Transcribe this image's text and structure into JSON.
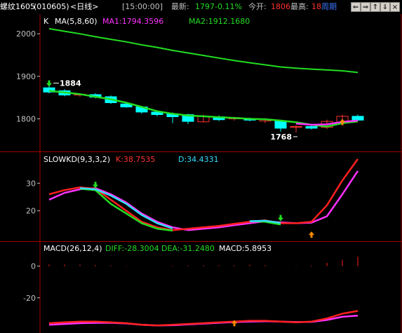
{
  "header": {
    "symbol": "螺纹1605",
    "code": "(010605)",
    "period": "<日线>",
    "time": "[15:00:00]",
    "latest_label": "最新:",
    "latest_value": "1797",
    "change": "-0.11%",
    "open_label": "今开:",
    "open_value": "1806",
    "high_label": "最高:",
    "high_value": "18",
    "week_label": "周期",
    "nav_icons": [
      "arrow-left-icon",
      "arrow-right-icon",
      "arrow-up-icon",
      "arrow-down-icon",
      "close-icon"
    ]
  },
  "colors": {
    "bg": "#000000",
    "divider": "#a00000",
    "axis": "#c0c0c0",
    "bull_candle": "#ff3232",
    "bear_candle": "#00ffff",
    "green_line": "#22dd22",
    "magenta_line": "#ff32ff",
    "red_line": "#ff2020",
    "cyan_line": "#33ddff"
  },
  "chart_data": [
    {
      "type": "line",
      "panel": "main",
      "legend_prefix": "K",
      "indicator": "MA(5,8,60)",
      "ma1_label": "MA1:1794.3596",
      "ma2_label": "MA2:1912.1680",
      "yticks": [
        2000,
        1900,
        1800
      ],
      "ylim": [
        1730,
        2030
      ],
      "annotations": {
        "high": "1884",
        "low": "1768"
      },
      "candles": [
        {
          "o": 1873,
          "h": 1884,
          "l": 1860,
          "c": 1863
        },
        {
          "o": 1866,
          "h": 1870,
          "l": 1853,
          "c": 1856
        },
        {
          "o": 1856,
          "h": 1860,
          "l": 1852,
          "c": 1858
        },
        {
          "o": 1857,
          "h": 1860,
          "l": 1848,
          "c": 1851
        },
        {
          "o": 1852,
          "h": 1855,
          "l": 1835,
          "c": 1838
        },
        {
          "o": 1835,
          "h": 1838,
          "l": 1826,
          "c": 1828
        },
        {
          "o": 1828,
          "h": 1830,
          "l": 1812,
          "c": 1816
        },
        {
          "o": 1816,
          "h": 1820,
          "l": 1806,
          "c": 1810
        },
        {
          "o": 1812,
          "h": 1815,
          "l": 1790,
          "c": 1805
        },
        {
          "o": 1810,
          "h": 1812,
          "l": 1788,
          "c": 1794
        },
        {
          "o": 1793,
          "h": 1810,
          "l": 1792,
          "c": 1806
        },
        {
          "o": 1805,
          "h": 1808,
          "l": 1795,
          "c": 1798
        },
        {
          "o": 1800,
          "h": 1805,
          "l": 1796,
          "c": 1803
        },
        {
          "o": 1800,
          "h": 1803,
          "l": 1794,
          "c": 1797
        },
        {
          "o": 1795,
          "h": 1802,
          "l": 1790,
          "c": 1799
        },
        {
          "o": 1795,
          "h": 1797,
          "l": 1770,
          "c": 1778
        },
        {
          "o": 1780,
          "h": 1785,
          "l": 1768,
          "c": 1782
        },
        {
          "o": 1782,
          "h": 1785,
          "l": 1775,
          "c": 1778
        },
        {
          "o": 1780,
          "h": 1798,
          "l": 1776,
          "c": 1794
        },
        {
          "o": 1792,
          "h": 1810,
          "l": 1790,
          "c": 1806
        },
        {
          "o": 1806,
          "h": 1810,
          "l": 1795,
          "c": 1797
        }
      ],
      "ma60": [
        2012,
        2006,
        2000,
        1993,
        1987,
        1981,
        1974,
        1968,
        1961,
        1955,
        1949,
        1943,
        1937,
        1932,
        1927,
        1922,
        1919,
        1917,
        1915,
        1913,
        1909
      ],
      "ma_short": [
        1866,
        1862,
        1858,
        1852,
        1846,
        1838,
        1828,
        1818,
        1812,
        1808,
        1806,
        1804,
        1802,
        1800,
        1799,
        1796,
        1792,
        1786,
        1782,
        1790,
        1794
      ],
      "ma_mid": [
        null,
        null,
        null,
        null,
        null,
        null,
        null,
        null,
        null,
        null,
        null,
        null,
        null,
        null,
        null,
        null,
        1789,
        1786,
        1787,
        1793,
        1796
      ]
    },
    {
      "type": "line",
      "panel": "kd",
      "legend": "SLOWKD(9,3,3,2)",
      "k_label": "K:38.7535",
      "d_label": "D:34.4331",
      "yticks": [
        30,
        20
      ],
      "ylim": [
        10,
        40
      ],
      "k": [
        26,
        27.5,
        28.5,
        28,
        24,
        20,
        16,
        14,
        13,
        13.5,
        14,
        14.5,
        15.3,
        16,
        16.5,
        15.5,
        15.5,
        16,
        22,
        31,
        38.75
      ],
      "d": [
        24,
        26.5,
        27.8,
        28.2,
        26,
        23,
        19,
        16,
        14,
        13,
        13.5,
        14,
        14.8,
        15.5,
        16.2,
        15.8,
        15.5,
        15.7,
        18,
        26,
        34.43
      ],
      "k2": [
        null,
        null,
        28,
        27.5,
        22.5,
        19,
        15.5,
        13.5,
        12.8,
        null,
        null,
        null,
        null,
        16.3,
        16,
        15,
        null,
        null,
        null,
        null,
        null
      ],
      "k2_alt": [
        null,
        null,
        28.2,
        27.8,
        25.5,
        22.5,
        18.5,
        15.5,
        13.6,
        null,
        null,
        null,
        null,
        16.2,
        16.4,
        15.6,
        null,
        null,
        null,
        null,
        null
      ]
    },
    {
      "type": "line",
      "panel": "macd",
      "legend": "MACD(26,12,4)",
      "diff_label": "DIFF:-28.3004",
      "dea_label": "DEA:-31.2480",
      "macd_label": "MACD:5.8953",
      "yticks": [
        0,
        -20
      ],
      "ylim": [
        -40,
        6
      ],
      "diff": [
        -36,
        -35.5,
        -35,
        -35,
        -35.5,
        -36,
        -37,
        -37.5,
        -37,
        -36.5,
        -36,
        -35.5,
        -35,
        -34.5,
        -34.5,
        -35,
        -35.5,
        -35,
        -33,
        -30,
        -28.3
      ],
      "dea": [
        -37,
        -36.5,
        -36,
        -35.8,
        -35.8,
        -36.2,
        -37,
        -37.5,
        -37.3,
        -36.8,
        -36.3,
        -35.8,
        -35.3,
        -35,
        -34.8,
        -35,
        -35.3,
        -35.2,
        -34,
        -32,
        -31.25
      ],
      "hist": [
        1.0,
        1.0,
        0.9,
        0.7,
        0.4,
        0.2,
        0.0,
        0.0,
        0.3,
        0.4,
        0.5,
        0.6,
        0.6,
        0.8,
        0.6,
        0.0,
        0.2,
        0.4,
        2.0,
        4.0,
        5.9
      ]
    }
  ]
}
